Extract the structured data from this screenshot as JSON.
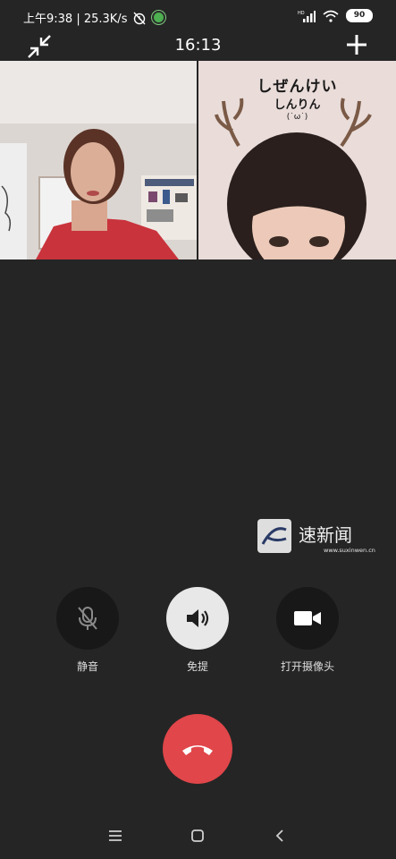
{
  "status_bar": {
    "time_speed": "上午9:38 | 25.3K/s",
    "network_tag": "HD",
    "battery": "90"
  },
  "call": {
    "timer": "16:13"
  },
  "remote_overlay": {
    "line1": "しぜんけい",
    "line2": "しんりん",
    "line3": "(˙ω˙)"
  },
  "watermark": {
    "brand": "速新闻",
    "url": "www.suxinwen.cn"
  },
  "controls": {
    "mute_label": "静音",
    "speaker_label": "免提",
    "camera_label": "打开摄像头"
  },
  "colors": {
    "background": "#252525",
    "hangup": "#e0464a",
    "speaker_active": "#e8e8e8"
  }
}
